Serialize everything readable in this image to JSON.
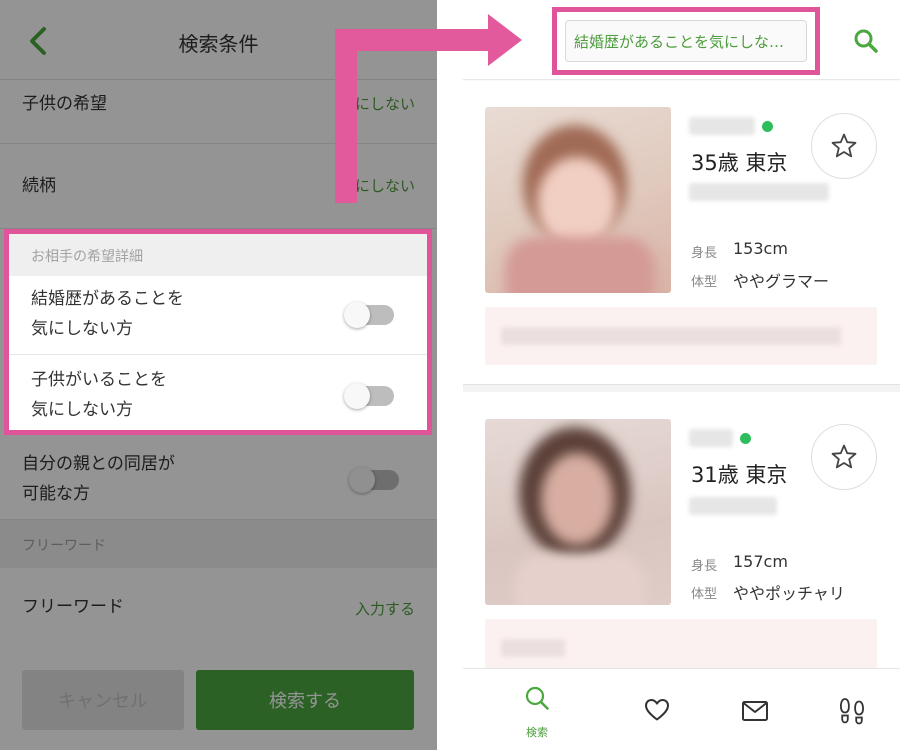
{
  "left": {
    "header": {
      "title": "検索条件"
    },
    "rows": [
      {
        "label": "子供の希望",
        "value": "気にしない"
      },
      {
        "label": "続柄",
        "value": "気にしない"
      }
    ],
    "section_detail": {
      "title": "お相手の希望詳細",
      "toggles": [
        {
          "line1": "結婚歴があることを",
          "line2": "気にしない方",
          "on": false
        },
        {
          "line1": "子供がいることを",
          "line2": "気にしない方",
          "on": false
        }
      ]
    },
    "toggle_parent": {
      "line1": "自分の親との同居が",
      "line2": "可能な方",
      "on": false
    },
    "section_freeword": {
      "title": "フリーワード"
    },
    "freeword_row": {
      "label": "フリーワード",
      "value": "入力する"
    },
    "buttons": {
      "cancel": "キャンセル",
      "search": "検索する"
    }
  },
  "right": {
    "search_query": "結婚歴があることを気にしな…",
    "cards": [
      {
        "age_location": "35歳 東京",
        "height_label": "身長",
        "height": "153cm",
        "body_label": "体型",
        "body": "ややグラマー"
      },
      {
        "age_location": "31歳 東京",
        "height_label": "身長",
        "height": "157cm",
        "body_label": "体型",
        "body": "ややポッチャリ"
      }
    ],
    "nav": [
      {
        "icon": "search-icon",
        "label": "検索",
        "active": true
      },
      {
        "icon": "heart-icon",
        "label": "",
        "active": false
      },
      {
        "icon": "mail-icon",
        "label": "",
        "active": false
      },
      {
        "icon": "footprints-icon",
        "label": "",
        "active": false
      }
    ]
  },
  "colors": {
    "accent_green": "#4aa83e",
    "highlight_pink": "#e0549a",
    "online_green": "#2ebd5c"
  }
}
